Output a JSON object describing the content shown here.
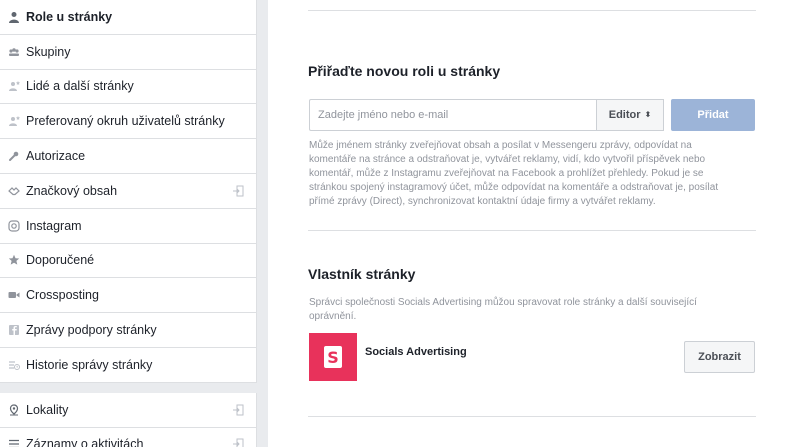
{
  "sidebar": {
    "items": [
      {
        "label": "Role u stránky",
        "icon": "person-icon",
        "active": true,
        "external": false
      },
      {
        "label": "Skupiny",
        "icon": "group-icon",
        "active": false,
        "external": false
      },
      {
        "label": "Lidé a další stránky",
        "icon": "person-star-icon",
        "active": false,
        "external": false
      },
      {
        "label": "Preferovaný okruh uživatelů stránky",
        "icon": "person-star-icon",
        "active": false,
        "external": false
      },
      {
        "label": "Autorizace",
        "icon": "wrench-icon",
        "active": false,
        "external": false
      },
      {
        "label": "Značkový obsah",
        "icon": "handshake-icon",
        "active": false,
        "external": true
      },
      {
        "label": "Instagram",
        "icon": "instagram-icon",
        "active": false,
        "external": false
      },
      {
        "label": "Doporučené",
        "icon": "star-icon",
        "active": false,
        "external": false
      },
      {
        "label": "Crossposting",
        "icon": "video-icon",
        "active": false,
        "external": false
      },
      {
        "label": "Zprávy podpory stránky",
        "icon": "facebook-icon",
        "active": false,
        "external": false
      },
      {
        "label": "Historie správy stránky",
        "icon": "history-icon",
        "active": false,
        "external": false
      }
    ],
    "items2": [
      {
        "label": "Lokality",
        "icon": "location-icon",
        "external": true
      },
      {
        "label": "Záznamy o aktivitách",
        "icon": "list-icon",
        "external": true
      }
    ]
  },
  "assign": {
    "title": "Přiřaďte novou roli u stránky",
    "placeholder": "Zadejte jméno nebo e-mail",
    "role_value": "Editor",
    "add_label": "Přidat",
    "description": "Může jménem stránky zveřejňovat obsah a posílat v Messengeru zprávy, odpovídat na komentáře na stránce a odstraňovat je, vytvářet reklamy, vidí, kdo vytvořil příspěvek nebo komentář, může z Instagramu zveřejňovat na Facebook a prohlížet přehledy. Pokud je se stránkou spojený instagramový účet, může odpovídat na komentáře a odstraňovat je, posílat přímé zprávy (Direct), synchronizovat kontaktní údaje firmy a vytvářet reklamy."
  },
  "owner": {
    "title": "Vlastník stránky",
    "description": "Správci společnosti Socials Advertising můžou spravovat role stránky a další související oprávnění.",
    "name": "Socials Advertising",
    "logo_letter": "S",
    "logo_color": "#e8325b",
    "view_label": "Zobrazit"
  }
}
